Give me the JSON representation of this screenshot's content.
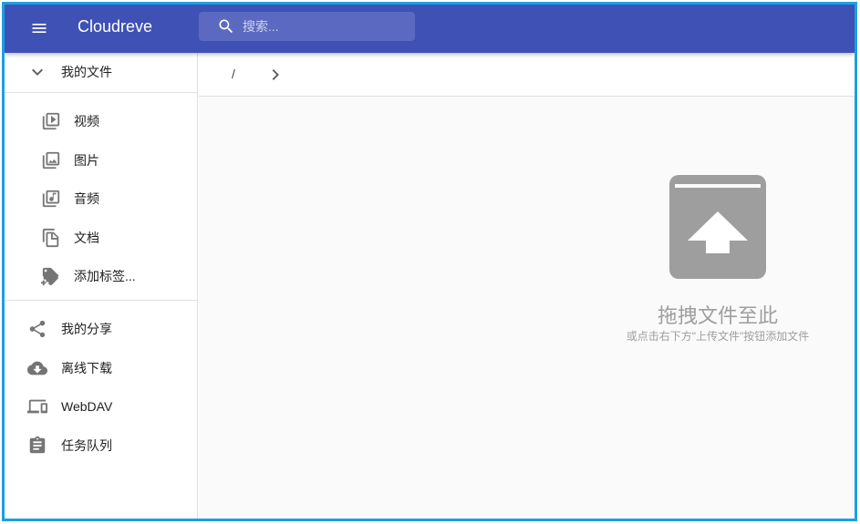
{
  "appbar": {
    "title": "Cloudreve",
    "search_placeholder": "搜索..."
  },
  "sidebar": {
    "my_files": "我的文件",
    "sub_items": [
      {
        "label": "视频",
        "icon": "video-library-icon"
      },
      {
        "label": "图片",
        "icon": "photo-library-icon"
      },
      {
        "label": "音频",
        "icon": "music-library-icon"
      },
      {
        "label": "文档",
        "icon": "file-copy-icon"
      },
      {
        "label": "添加标签...",
        "icon": "add-tag-icon"
      }
    ],
    "items": [
      {
        "label": "我的分享",
        "icon": "share-icon"
      },
      {
        "label": "离线下载",
        "icon": "cloud-download-icon"
      },
      {
        "label": "WebDAV",
        "icon": "devices-icon"
      },
      {
        "label": "任务队列",
        "icon": "assignment-icon"
      }
    ]
  },
  "breadcrumb": {
    "root": "/"
  },
  "empty_state": {
    "title": "拖拽文件至此",
    "subtitle": "或点击右下方\"上传文件\"按钮添加文件",
    "icon": "upload-box-icon"
  },
  "colors": {
    "appbar": "#3f51b5",
    "icon_gray": "#757575",
    "empty_gray": "#9e9e9e",
    "frame_border": "#1ba1e2"
  }
}
